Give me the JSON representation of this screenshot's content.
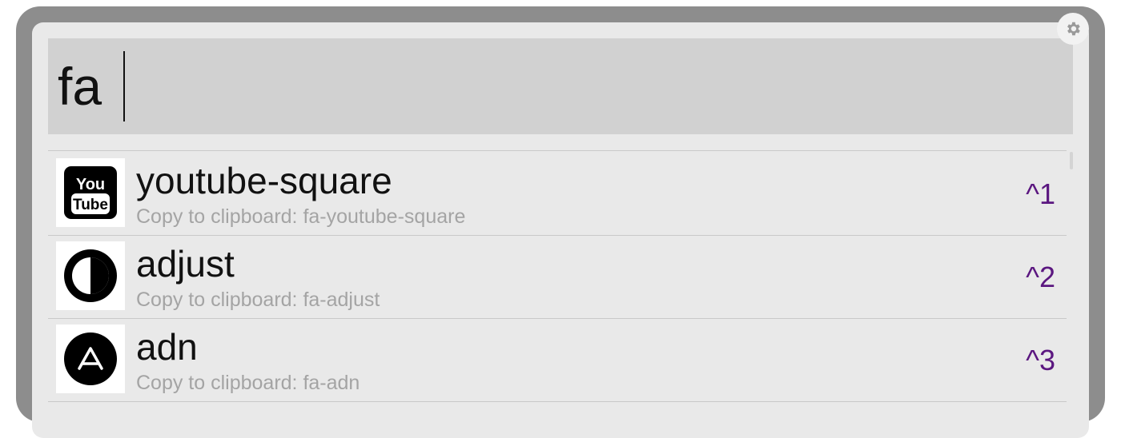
{
  "search": {
    "query": "fa"
  },
  "settings": {
    "icon": "gear-icon"
  },
  "results": [
    {
      "title": "youtube-square",
      "subtitle": "Copy to clipboard: fa-youtube-square",
      "shortcut": "^1",
      "icon": "youtube-square-icon",
      "icon_text_top": "You",
      "icon_text_bottom": "Tube"
    },
    {
      "title": "adjust",
      "subtitle": "Copy to clipboard: fa-adjust",
      "shortcut": "^2",
      "icon": "adjust-icon"
    },
    {
      "title": "adn",
      "subtitle": "Copy to clipboard: fa-adn",
      "shortcut": "^3",
      "icon": "adn-icon"
    }
  ],
  "colors": {
    "shortcut": "#5b1780",
    "subtitle": "#a4a4a4",
    "search_background": "#d1d1d1",
    "panel_background": "#e9e9e9",
    "window_frame": "#8d8d8d"
  }
}
